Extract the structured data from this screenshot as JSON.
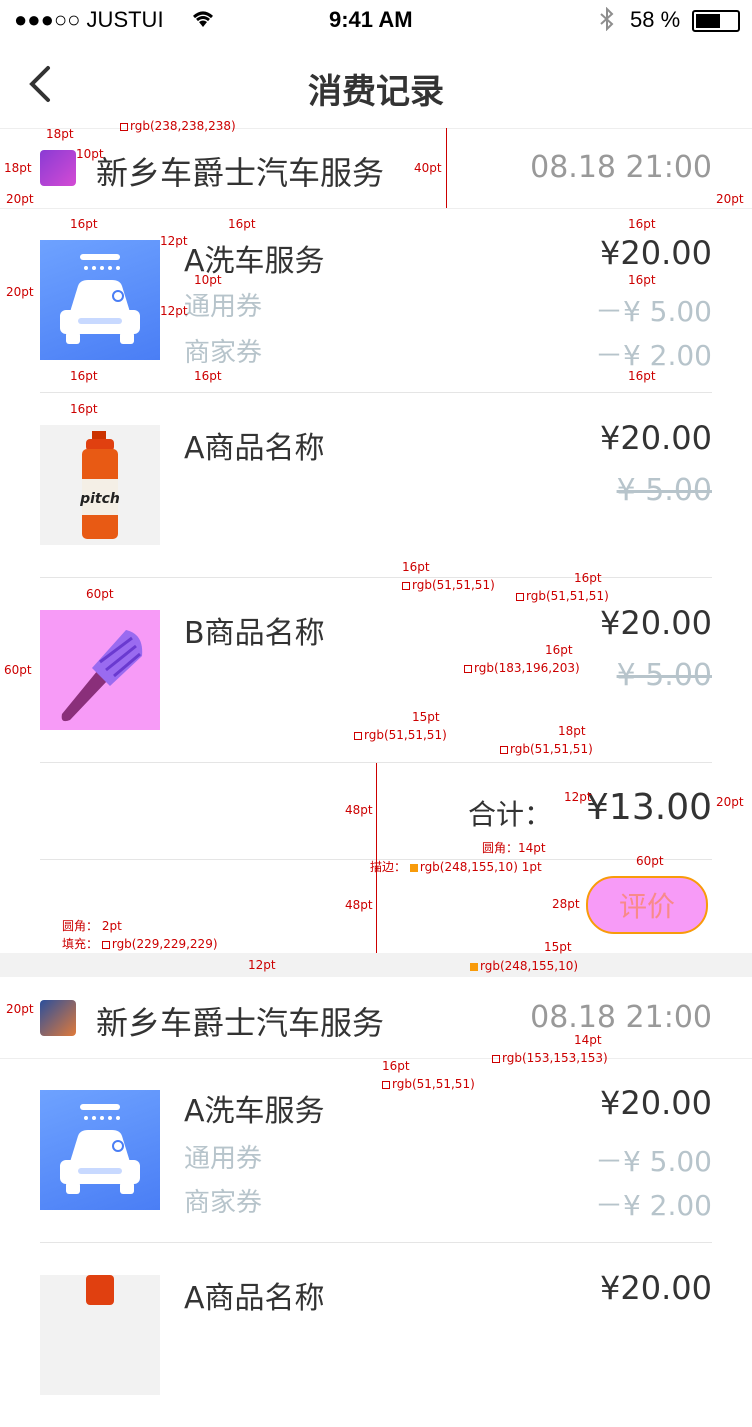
{
  "status_bar": {
    "carrier": "●●●○○ JUSTUI",
    "time": "9:41 AM",
    "battery": "58 %"
  },
  "nav": {
    "title": "消费记录",
    "back_icon": "chevron-left-icon"
  },
  "orders": [
    {
      "shop_name": "新乡车爵士汽车服务",
      "time": "08.18 21:00",
      "items": [
        {
          "title": "A洗车服务",
          "price": "¥20.00",
          "discounts": [
            {
              "label": "通用券",
              "amount": "－¥ 5.00"
            },
            {
              "label": "商家券",
              "amount": "－¥ 2.00"
            }
          ]
        },
        {
          "title": "A商品名称",
          "price": "¥20.00",
          "original_price": "¥ 5.00"
        },
        {
          "title": "B商品名称",
          "price": "¥20.00",
          "original_price": "¥ 5.00"
        }
      ],
      "total_label": "合计：",
      "total_value": "¥13.00",
      "review_button": "评价"
    },
    {
      "shop_name": "新乡车爵士汽车服务",
      "time": "08.18 21:00",
      "items": [
        {
          "title": "A洗车服务",
          "price": "¥20.00",
          "discounts": [
            {
              "label": "通用券",
              "amount": "－¥ 5.00"
            },
            {
              "label": "商家券",
              "amount": "－¥ 2.00"
            }
          ]
        },
        {
          "title": "A商品名称",
          "price": "¥20.00"
        }
      ]
    }
  ],
  "annotations": {
    "divider_color": "rgb(238,238,238)",
    "pt18": "18pt",
    "pt10": "10pt",
    "pt20": "20pt",
    "pt40": "40pt",
    "pt16": "16pt",
    "pt12": "12pt",
    "pt60": "60pt",
    "pt48": "48pt",
    "pt15": "15pt",
    "pt14": "14pt",
    "pt28": "28pt",
    "c_333": "rgb(51,51,51)",
    "c_gray": "rgb(183,196,203)",
    "c_orange": "rgb(248,155,10)",
    "c_999": "rgb(153,153,153)",
    "stroke_note": "描边：",
    "stroke_width": "1pt",
    "radius_label": "圆角：",
    "radius_2pt": "2pt",
    "radius_14pt": "14pt",
    "fill_note": "填充：",
    "fill_color": "rgb(229,229,229)"
  },
  "colors": {
    "text": "#333333",
    "muted": "#b7c4cb",
    "time": "#999999",
    "divider": "#eeeeee",
    "accent": "#f89b0a",
    "wash_blue": "#5b8ff9"
  }
}
